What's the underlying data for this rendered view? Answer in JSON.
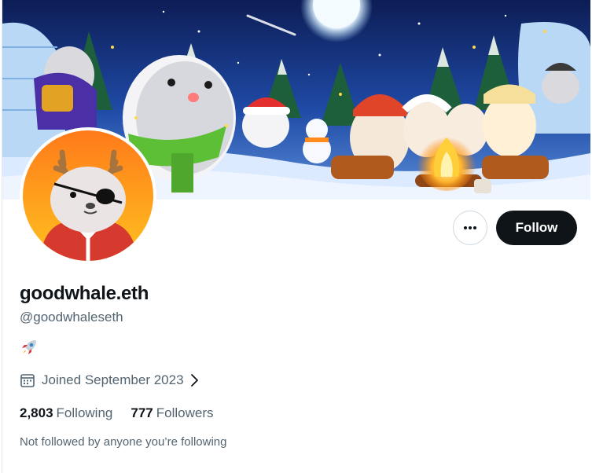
{
  "profile": {
    "display_name": "goodwhale.eth",
    "handle": "@goodwhaleseth",
    "bio_icon": "rocket-emoji",
    "joined": "Joined September 2023",
    "following_count": "2,803",
    "following_label": "Following",
    "followers_count": "777",
    "followers_label": "Followers",
    "followed_by_note": "Not followed by anyone you’re following"
  },
  "actions": {
    "more_icon": "more-dots-icon",
    "follow_label": "Follow"
  },
  "icons": {
    "calendar": "calendar-icon",
    "chevron": "chevron-right-icon"
  },
  "colors": {
    "primary_text": "#0f1419",
    "secondary_text": "#536471",
    "follow_button_bg": "#0f1419",
    "border": "#cfd9de"
  }
}
